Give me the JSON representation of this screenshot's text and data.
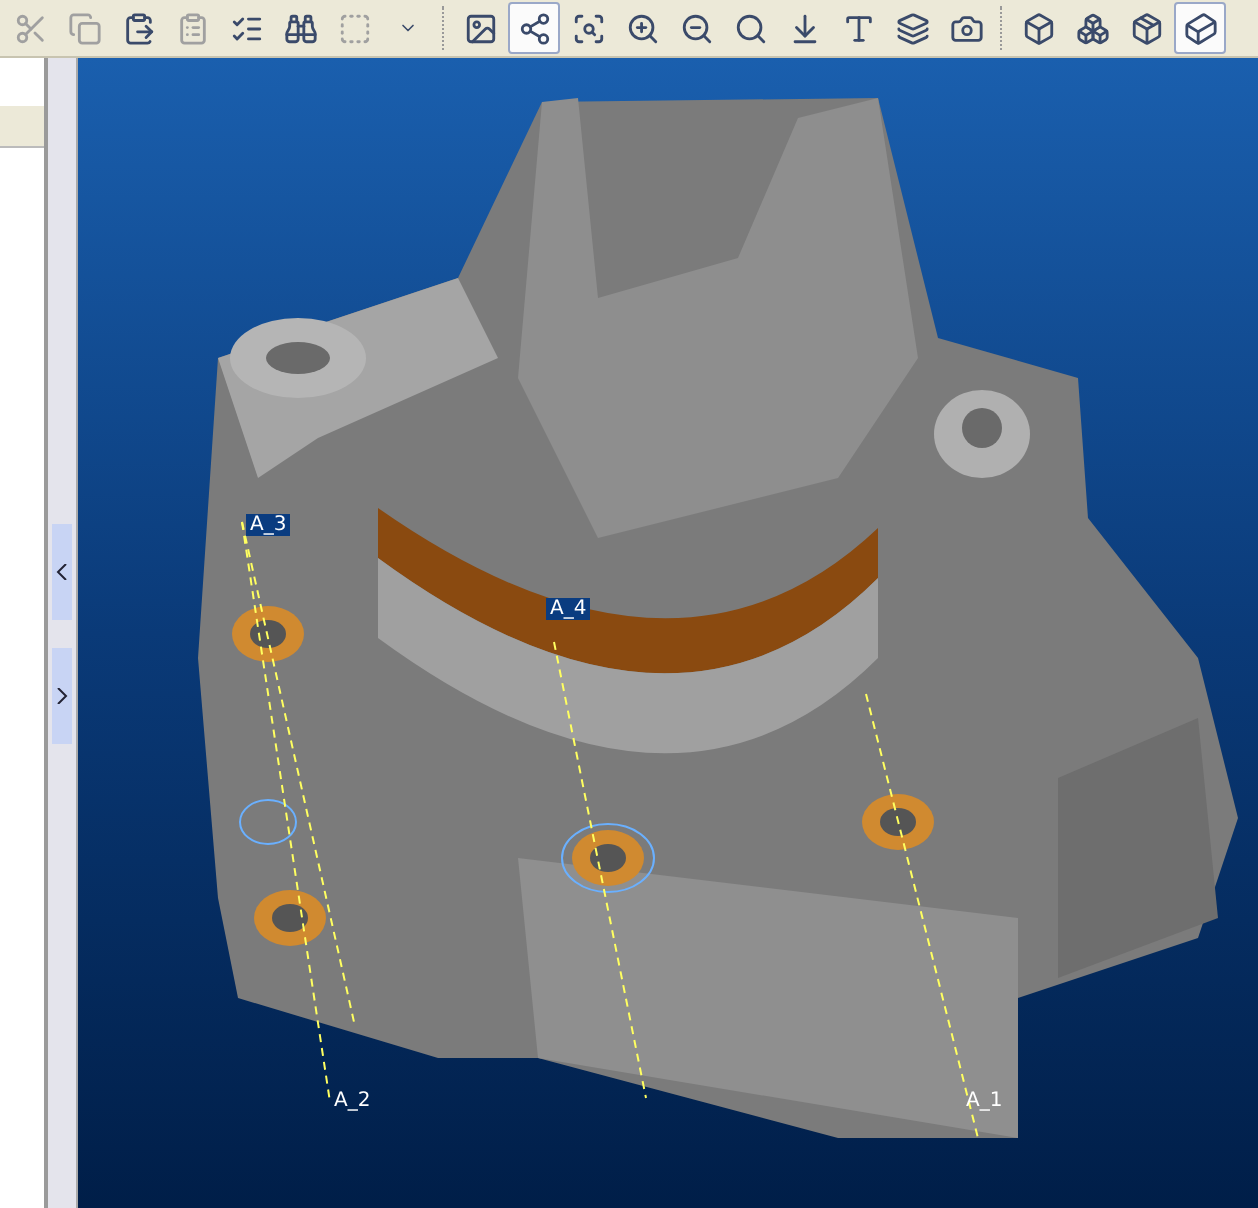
{
  "toolbar": {
    "buttons": [
      {
        "selected": false
      },
      {
        "selected": false
      },
      {
        "selected": false
      },
      {
        "selected": false
      },
      {
        "selected": false
      },
      {
        "selected": false
      },
      {
        "selected": false
      },
      {
        "selected": false
      },
      {
        "selected": false
      },
      {
        "selected": true
      },
      {
        "selected": false
      },
      {
        "selected": false
      },
      {
        "selected": false
      },
      {
        "selected": false
      },
      {
        "selected": false
      },
      {
        "selected": false
      },
      {
        "selected": false
      },
      {
        "selected": false
      },
      {
        "selected": false
      },
      {
        "selected": false
      },
      {
        "selected": false
      },
      {
        "selected": true
      }
    ]
  },
  "viewport": {
    "axes": [
      {
        "label": "A_3"
      },
      {
        "label": "A_4"
      },
      {
        "label": "A_2"
      },
      {
        "label": "A_1"
      }
    ]
  }
}
